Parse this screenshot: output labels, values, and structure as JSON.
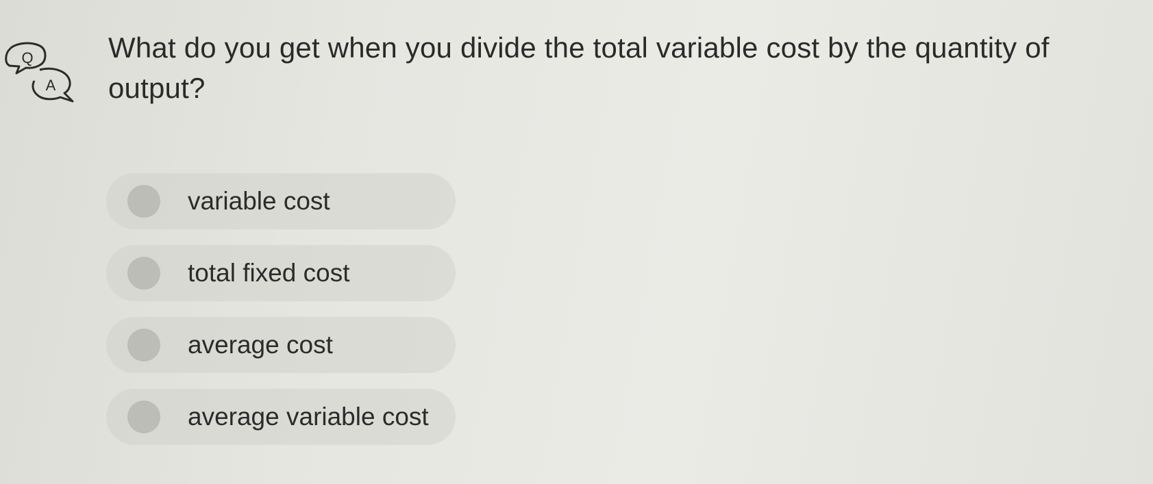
{
  "qa_badge": {
    "icon": "question-answer-bubbles-icon",
    "q_letter": "Q",
    "a_letter": "A"
  },
  "question": {
    "text": "What do you get when you divide the total variable cost by the quantity of output?"
  },
  "options": [
    {
      "label": "variable cost"
    },
    {
      "label": "total fixed cost"
    },
    {
      "label": "average cost"
    },
    {
      "label": "average variable cost"
    }
  ],
  "colors": {
    "background": "#e6e6e1",
    "option_fill": "#d4d4ce",
    "radio_fill": "#bdbdb8",
    "text": "#2b2b2b"
  }
}
